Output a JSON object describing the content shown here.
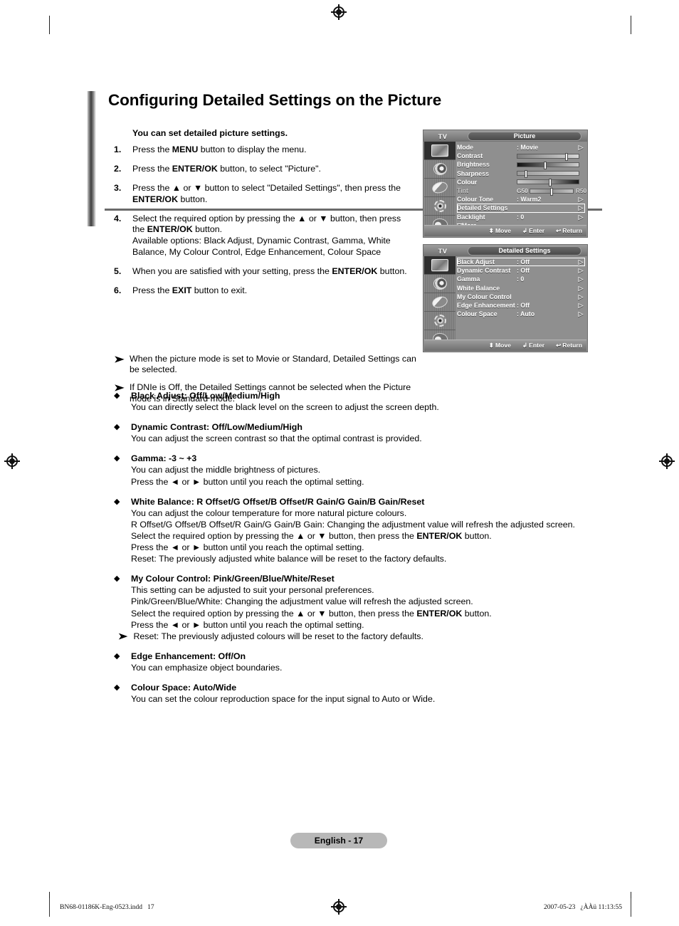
{
  "page": {
    "title": "Configuring Detailed Settings on the Picture",
    "lead": "You can set detailed picture settings.",
    "page_pill": "English - 17"
  },
  "steps": [
    {
      "num": "1.",
      "parts": [
        {
          "t": "Press the "
        },
        {
          "t": "MENU",
          "b": true
        },
        {
          "t": " button to display the menu."
        }
      ]
    },
    {
      "num": "2.",
      "parts": [
        {
          "t": "Press the "
        },
        {
          "t": "ENTER/OK",
          "b": true
        },
        {
          "t": " button, to select \"Picture\"."
        }
      ]
    },
    {
      "num": "3.",
      "parts": [
        {
          "t": "Press the ▲ or ▼ button to select \"Detailed Settings\", then press the "
        },
        {
          "t": "ENTER/OK",
          "b": true
        },
        {
          "t": " button."
        }
      ]
    },
    {
      "num": "4.",
      "parts": [
        {
          "t": "Select the required option by pressing the ▲ or ▼ button, then press the "
        },
        {
          "t": "ENTER/OK",
          "b": true
        },
        {
          "t": " button."
        },
        {
          "t": "\nAvailable options: Black Adjust, Dynamic Contrast, Gamma, White Balance, My Colour Control, Edge Enhancement, Colour Space"
        }
      ]
    },
    {
      "num": "5.",
      "parts": [
        {
          "t": "When you are satisfied with your setting, press the "
        },
        {
          "t": "ENTER/OK",
          "b": true
        },
        {
          "t": " button."
        }
      ]
    },
    {
      "num": "6.",
      "parts": [
        {
          "t": "Press the "
        },
        {
          "t": "EXIT",
          "b": true
        },
        {
          "t": " button to exit."
        }
      ]
    }
  ],
  "notes": [
    {
      "bullet": "➤",
      "text": "When the picture mode is set to Movie or Standard, Detailed Settings can be selected."
    },
    {
      "bullet": "➤",
      "text": "If DNIe is Off, the Detailed Settings cannot be selected when the Picture mode is in Standard mode."
    }
  ],
  "sections": [
    {
      "bullet": "◆",
      "head": "Black Adjust: Off/Low/Medium/High",
      "lines": [
        "You can directly select the black level on the screen to adjust the screen depth."
      ]
    },
    {
      "bullet": "◆",
      "head": "Dynamic Contrast: Off/Low/Medium/High",
      "lines": [
        "You can adjust the screen contrast so that the optimal contrast is provided."
      ]
    },
    {
      "bullet": "◆",
      "head": "Gamma: -3 ~ +3",
      "lines": [
        "You can adjust the middle brightness of pictures.",
        "Press the ◄ or ► button until you reach the optimal setting."
      ]
    },
    {
      "bullet": "◆",
      "head": "White Balance: R Offset/G Offset/B Offset/R Gain/G Gain/B Gain/Reset",
      "lines": [
        "You can adjust the colour temperature for more natural picture colours.",
        "R Offset/G Offset/B Offset/R Gain/G Gain/B Gain: Changing the adjustment value will refresh the adjusted screen.",
        "Select the required option by pressing the ▲ or ▼ button, then press the |ENTER/OK| button.",
        "Press the ◄ or ► button until you reach the optimal setting.",
        "Reset: The previously adjusted white balance will be reset to the factory defaults."
      ]
    },
    {
      "bullet": "◆",
      "head": "My Colour Control: Pink/Green/Blue/White/Reset",
      "lines": [
        "This setting can be adjusted to suit your personal preferences.",
        "Pink/Green/Blue/White: Changing the adjustment value will refresh the adjusted screen.",
        "Select the required option by pressing the ▲ or ▼ button, then press the |ENTER/OK| button.",
        "Press the ◄ or ► button until you reach the optimal setting.",
        "➤ Reset: The previously adjusted colours will be reset to the factory defaults."
      ]
    },
    {
      "bullet": "◆",
      "head": "Edge Enhancement: Off/On",
      "lines": [
        "You can emphasize object boundaries."
      ]
    },
    {
      "bullet": "◆",
      "head": "Colour Space: Auto/Wide",
      "lines": [
        "You can set the colour reproduction space for the input signal to Auto or Wide."
      ]
    }
  ],
  "osd_picture": {
    "tv_label": "TV",
    "title": "Picture",
    "rows": [
      {
        "label": "Mode",
        "value": ": Movie",
        "arrow": "▷",
        "type": "value"
      },
      {
        "label": "Contrast",
        "num": "80",
        "type": "slider",
        "knob_pct": 80,
        "style": "sl-contrast"
      },
      {
        "label": "Brightness",
        "num": "45",
        "type": "slider",
        "knob_pct": 45,
        "style": "sl-brightness"
      },
      {
        "label": "Sharpness",
        "num": "10",
        "type": "slider",
        "knob_pct": 14,
        "style": "sl-sharpness"
      },
      {
        "label": "Colour",
        "num": "53",
        "type": "slider",
        "knob_pct": 53,
        "style": "sl-colour"
      },
      {
        "label": "Tint",
        "type": "tint",
        "left": "G50",
        "right": "R50",
        "knob_pct": 50,
        "style": "sl-tint",
        "dim": true
      },
      {
        "label": "Colour Tone",
        "value": ": Warm2",
        "arrow": "▷",
        "type": "value"
      },
      {
        "label": "Detailed Settings",
        "value": "",
        "arrow": "▷",
        "type": "value",
        "boxed": true
      },
      {
        "label": "Backlight",
        "value": ": 0",
        "arrow": "▷",
        "type": "value"
      }
    ],
    "more": "▽More",
    "hints": [
      {
        "key": "⬍",
        "label": "Move"
      },
      {
        "key": "↲",
        "label": "Enter"
      },
      {
        "key": "↩",
        "label": "Return"
      }
    ]
  },
  "osd_detailed": {
    "tv_label": "TV",
    "title": "Detailed Settings",
    "rows": [
      {
        "label": "Black Adjust",
        "value": ": Off",
        "arrow": "▷",
        "boxed": true
      },
      {
        "label": "Dynamic Contrast",
        "value": ": Off",
        "arrow": "▷"
      },
      {
        "label": "Gamma",
        "value": ": 0",
        "arrow": "▷"
      },
      {
        "label": "White Balance",
        "value": "",
        "arrow": "▷"
      },
      {
        "label": "My Colour Control",
        "value": "",
        "arrow": "▷"
      },
      {
        "label": "Edge Enhancement",
        "value": ": Off",
        "arrow": "▷"
      },
      {
        "label": "Colour Space",
        "value": ": Auto",
        "arrow": "▷"
      }
    ],
    "hints": [
      {
        "key": "⬍",
        "label": "Move"
      },
      {
        "key": "↲",
        "label": "Enter"
      },
      {
        "key": "↩",
        "label": "Return"
      }
    ]
  },
  "footer": {
    "left": "BN68-01186K-Eng-0523.indd   17",
    "right": "2007-05-23   ¿ÀÀü 11:13:55"
  }
}
